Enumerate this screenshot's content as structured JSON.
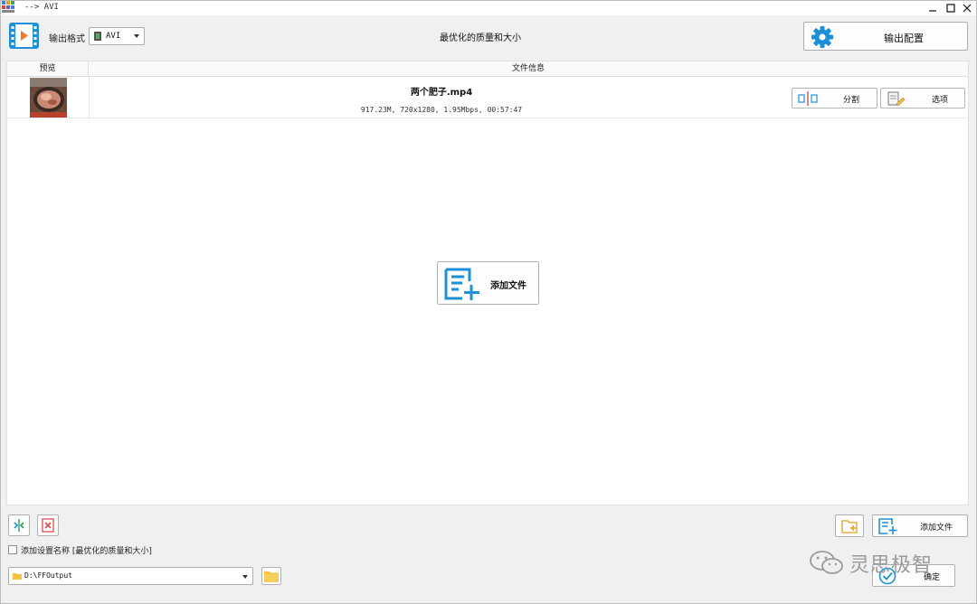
{
  "window": {
    "title": "--> AVI"
  },
  "toolbar": {
    "format_label": "输出格式",
    "format_value": "AVI",
    "center_title": "最优化的质量和大小",
    "output_config_label": "输出配置"
  },
  "list": {
    "headers": {
      "preview": "预览",
      "file_info": "文件信息"
    },
    "files": [
      {
        "name": "两个肥子.mp4",
        "meta": "917.23M, 720x1280, 1.95Mbps, 00:57:47",
        "split_label": "分割",
        "options_label": "选项"
      }
    ],
    "add_file_label": "添加文件"
  },
  "bottom": {
    "add_file_label": "添加文件",
    "checkbox_label": "添加设置名称 [最优化的质量和大小]",
    "checkbox_checked": false,
    "output_path": "D:\\FFOutput",
    "ok_label": "确定"
  },
  "watermark": {
    "text": "灵思极智"
  },
  "colors": {
    "accent_blue": "#1e90d6",
    "gear_blue": "#1a8fd8",
    "folder_yellow": "#f5c342",
    "red": "#e04a4a",
    "green": "#2aa060"
  }
}
